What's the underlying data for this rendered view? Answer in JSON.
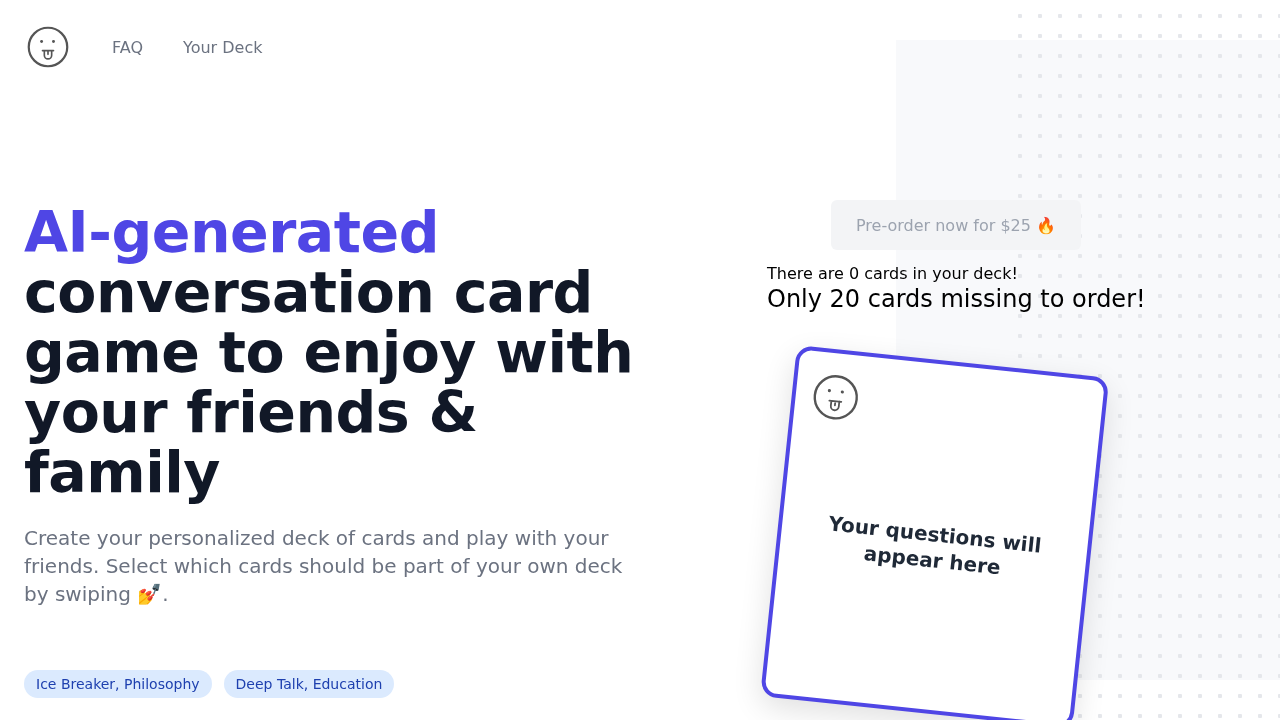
{
  "nav": {
    "links": [
      "FAQ",
      "Your Deck"
    ]
  },
  "hero": {
    "headline_accent": "AI-generated",
    "headline_rest": "conversation card game to enjoy with your friends & family",
    "description": "Create your personalized deck of cards and play with your friends. Select which cards should be part of your own deck by swiping 💅.",
    "tags": [
      "Ice Breaker, Philosophy",
      "Deep Talk, Education"
    ]
  },
  "order": {
    "button": {
      "label": "Pre-order now for $25 🔥",
      "disabled": true
    },
    "deck_count": "There are 0 cards in your deck!",
    "missing": "Only 20 cards missing to order!"
  },
  "card": {
    "text": "Your questions will appear here"
  }
}
